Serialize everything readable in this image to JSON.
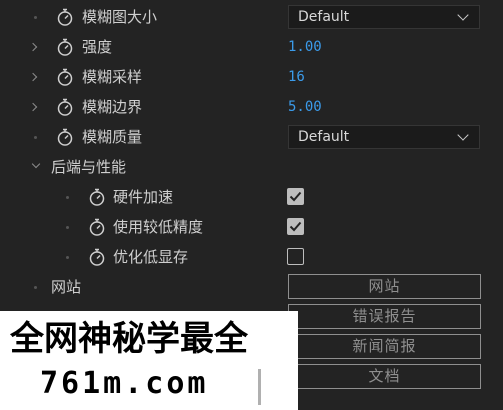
{
  "properties": {
    "blur_map_size": {
      "label": "模糊图大小",
      "value": "Default"
    },
    "strength": {
      "label": "强度",
      "value": "1.00"
    },
    "blur_sampling": {
      "label": "模糊采样",
      "value": "16"
    },
    "blur_border": {
      "label": "模糊边界",
      "value": "5.00"
    },
    "blur_quality": {
      "label": "模糊质量",
      "value": "Default"
    }
  },
  "backend_group": {
    "label": "后端与性能",
    "hardware_acceleration": {
      "label": "硬件加速",
      "checked": true
    },
    "lower_precision": {
      "label": "使用较低精度",
      "checked": true
    },
    "optimize_low_memory": {
      "label": "优化低显存",
      "checked": false
    }
  },
  "website_row": {
    "label": "网站"
  },
  "buttons": {
    "website": "网站",
    "bug_report": "错误报告",
    "news": "新闻简报",
    "docs": "文档"
  },
  "watermark": {
    "title": "全网神秘学最全",
    "domain": "761m.com"
  },
  "colors": {
    "background": "#232323",
    "value_blue": "#3b9bea",
    "text": "#cfcfcf"
  }
}
